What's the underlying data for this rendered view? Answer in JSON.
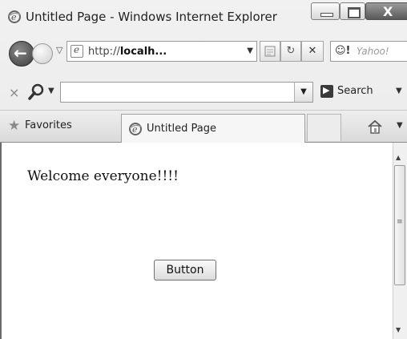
{
  "window": {
    "title": "Untitled Page - Windows Internet Explorer",
    "close_glyph": "X"
  },
  "navigation": {
    "address_prefix": "http://",
    "address_host": "localh...",
    "search_provider_placeholder": "Yahoo!",
    "refresh_glyph": "↻",
    "stop_glyph": "✕"
  },
  "search_bar": {
    "close_glyph": "×",
    "search_label": "Search",
    "input_value": ""
  },
  "favorites_bar": {
    "favorites_label": "Favorites",
    "tab_title": "Untitled Page"
  },
  "page": {
    "welcome_text": "Welcome everyone!!!!",
    "button_label": "Button"
  },
  "colors": {
    "chrome_bg": "#e4e4e4",
    "content_bg": "#ffffff",
    "close_button": "#5a5a5a"
  },
  "icons": {
    "title": "ie-logo-icon",
    "back": "back-arrow-icon",
    "forward": "forward-arrow-icon",
    "search": "magnifier-icon",
    "favorites": "star-icon",
    "home": "home-icon"
  }
}
